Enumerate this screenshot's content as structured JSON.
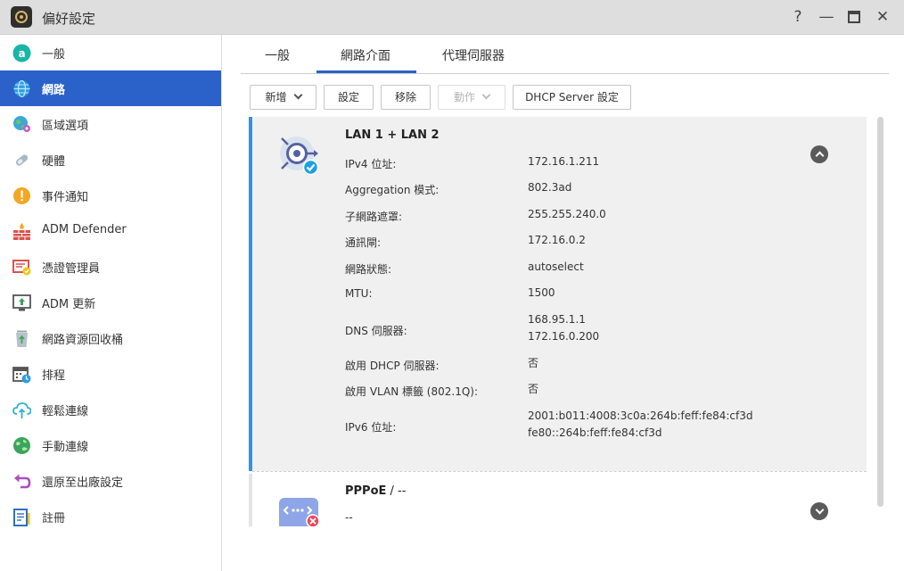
{
  "window": {
    "title": "偏好設定",
    "help": "?",
    "minimize": "—",
    "maximize": "□",
    "close": "✕"
  },
  "sidebar": {
    "items": [
      {
        "label": "一般",
        "icon": "general-icon"
      },
      {
        "label": "網路",
        "icon": "globe-icon",
        "active": true
      },
      {
        "label": "區域選項",
        "icon": "region-icon"
      },
      {
        "label": "硬體",
        "icon": "hardware-icon"
      },
      {
        "label": "事件通知",
        "icon": "alert-icon"
      },
      {
        "label": "ADM Defender",
        "icon": "firewall-icon"
      },
      {
        "label": "憑證管理員",
        "icon": "certificate-icon"
      },
      {
        "label": "ADM 更新",
        "icon": "update-icon"
      },
      {
        "label": "網路資源回收桶",
        "icon": "recycle-bin-icon"
      },
      {
        "label": "排程",
        "icon": "schedule-icon"
      },
      {
        "label": "輕鬆連線",
        "icon": "cloud-connect-icon"
      },
      {
        "label": "手動連線",
        "icon": "manual-connect-icon"
      },
      {
        "label": "還原至出廠設定",
        "icon": "reset-icon"
      },
      {
        "label": "註冊",
        "icon": "register-icon"
      }
    ]
  },
  "tabs": [
    {
      "label": "一般"
    },
    {
      "label": "網路介面",
      "active": true
    },
    {
      "label": "代理伺服器"
    }
  ],
  "toolbar": {
    "add_label": "新增",
    "settings_label": "設定",
    "remove_label": "移除",
    "action_label": "動作",
    "dhcp_label": "DHCP Server 設定"
  },
  "lan": {
    "title": "LAN 1 + LAN 2",
    "fields": [
      {
        "label": "IPv4 位址:",
        "value": "172.16.1.211"
      },
      {
        "label": "Aggregation 模式:",
        "value": "802.3ad"
      },
      {
        "label": "子網路遮罩:",
        "value": "255.255.240.0"
      },
      {
        "label": "通訊閘:",
        "value": "172.16.0.2"
      },
      {
        "label": "網路狀態:",
        "value": "autoselect"
      },
      {
        "label": "MTU:",
        "value": "1500"
      },
      {
        "label": "DNS 伺服器:",
        "value": "168.95.1.1",
        "value2": "172.16.0.200"
      },
      {
        "label": "啟用 DHCP 伺服器:",
        "value": "否"
      },
      {
        "label": "啟用 VLAN 標籤 (802.1Q):",
        "value": "否"
      },
      {
        "label": "IPv6 位址:",
        "value": "2001:b011:4008:3c0a:264b:feff:fe84:cf3d",
        "value2": "fe80::264b:feff:fe84:cf3d"
      }
    ]
  },
  "pppoe": {
    "title": "PPPoE",
    "title_suffix": " / --",
    "value": "--"
  },
  "colors": {
    "accent": "#2a62c9",
    "selected_border": "#3c8fde"
  }
}
